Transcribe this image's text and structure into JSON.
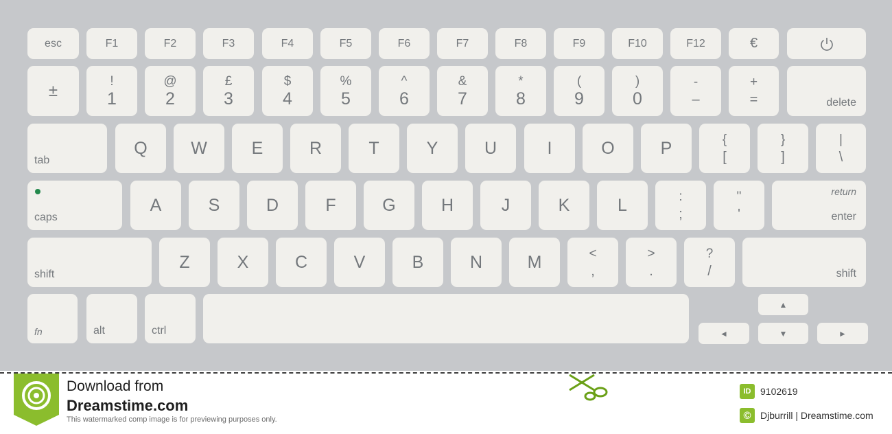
{
  "keyboard": {
    "function_row": [
      "esc",
      "F1",
      "F2",
      "F3",
      "F4",
      "F5",
      "F6",
      "F7",
      "F8",
      "F9",
      "F10",
      "F12",
      "€"
    ],
    "number_row": {
      "backtick": {
        "top": "±",
        "bottom": "±"
      },
      "keys": [
        {
          "top": "!",
          "bottom": "1"
        },
        {
          "top": "@",
          "bottom": "2"
        },
        {
          "top": "£",
          "bottom": "3"
        },
        {
          "top": "$",
          "bottom": "4"
        },
        {
          "top": "%",
          "bottom": "5"
        },
        {
          "top": "^",
          "bottom": "6"
        },
        {
          "top": "&",
          "bottom": "7"
        },
        {
          "top": "*",
          "bottom": "8"
        },
        {
          "top": "(",
          "bottom": "9"
        },
        {
          "top": ")",
          "bottom": "0"
        },
        {
          "top": "-",
          "bottom": "–"
        },
        {
          "top": "+",
          "bottom": "="
        }
      ],
      "delete": "delete"
    },
    "qwerty_row": {
      "tab": "tab",
      "letters": [
        "Q",
        "W",
        "E",
        "R",
        "T",
        "Y",
        "U",
        "I",
        "O",
        "P"
      ],
      "brackets": [
        {
          "top": "{",
          "bottom": "["
        },
        {
          "top": "}",
          "bottom": "]"
        },
        {
          "top": "|",
          "bottom": "\\"
        }
      ]
    },
    "home_row": {
      "caps": "caps",
      "letters": [
        "A",
        "S",
        "D",
        "F",
        "G",
        "H",
        "J",
        "K",
        "L"
      ],
      "punct": [
        {
          "top": ":",
          "bottom": ";"
        },
        {
          "top": "\"",
          "bottom": "'"
        }
      ],
      "enter_top": "return",
      "enter": "enter"
    },
    "bottom_row": {
      "shift_left": "shift",
      "letters": [
        "Z",
        "X",
        "C",
        "V",
        "B",
        "N",
        "M"
      ],
      "punct": [
        {
          "top": "<",
          "bottom": ","
        },
        {
          "top": ">",
          "bottom": "."
        },
        {
          "top": "?",
          "bottom": "/"
        }
      ],
      "shift_right": "shift"
    },
    "space_row": {
      "fn": "fn",
      "alt": "alt",
      "ctrl": "ctrl",
      "arrows": {
        "up": "▲",
        "left": "◄",
        "down": "▼",
        "right": "►"
      }
    }
  },
  "footer": {
    "line1": "Download from",
    "line2": "Dreamstime.com",
    "line3": "This watermarked comp image is for previewing purposes only.",
    "id_badge": "ID",
    "id_value": "9102619",
    "copyright_badge": "©",
    "credit": "Djburrill | Dreamstime.com"
  },
  "colors": {
    "keyboard_bg": "#c6c8cb",
    "key_face": "#f1f0ec",
    "key_text": "#74787c",
    "caps_led": "#23894c",
    "brand_green": "#8bbd2d"
  },
  "icons": [
    "power-icon",
    "dreamstime-logo",
    "scissors-icon"
  ]
}
